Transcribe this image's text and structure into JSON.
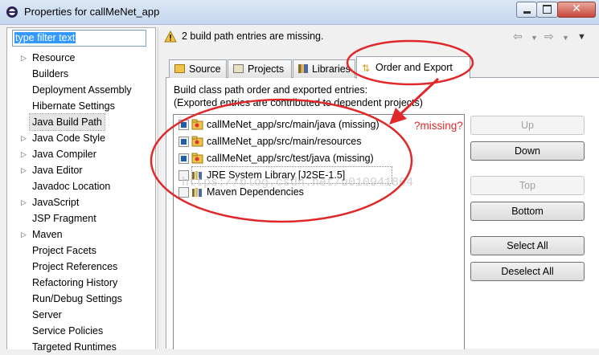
{
  "window": {
    "title": "Properties for callMeNet_app"
  },
  "filter": {
    "value": "type filter text"
  },
  "tree": {
    "items": [
      {
        "label": "Resource",
        "arrow": true
      },
      {
        "label": "Builders",
        "arrow": false
      },
      {
        "label": "Deployment Assembly",
        "arrow": false
      },
      {
        "label": "Hibernate Settings",
        "arrow": false
      },
      {
        "label": "Java Build Path",
        "arrow": false,
        "selected": true
      },
      {
        "label": "Java Code Style",
        "arrow": true
      },
      {
        "label": "Java Compiler",
        "arrow": true
      },
      {
        "label": "Java Editor",
        "arrow": true
      },
      {
        "label": "Javadoc Location",
        "arrow": false
      },
      {
        "label": "JavaScript",
        "arrow": true
      },
      {
        "label": "JSP Fragment",
        "arrow": false
      },
      {
        "label": "Maven",
        "arrow": true
      },
      {
        "label": "Project Facets",
        "arrow": false
      },
      {
        "label": "Project References",
        "arrow": false
      },
      {
        "label": "Refactoring History",
        "arrow": false
      },
      {
        "label": "Run/Debug Settings",
        "arrow": false
      },
      {
        "label": "Server",
        "arrow": false
      },
      {
        "label": "Service Policies",
        "arrow": false
      },
      {
        "label": "Targeted Runtimes",
        "arrow": false
      }
    ]
  },
  "header": {
    "warning": "2 build path entries are missing."
  },
  "tabs": [
    {
      "label": "Source"
    },
    {
      "label": "Projects"
    },
    {
      "label": "Libraries"
    },
    {
      "label": "Order and Export",
      "active": true
    }
  ],
  "panel": {
    "desc1": "Build class path order and exported entries:",
    "desc2": "(Exported entries are contributed to dependent projects)"
  },
  "entries": [
    {
      "label": "callMeNet_app/src/main/java (missing)",
      "checked": true,
      "icon": "source-folder-icon"
    },
    {
      "label": "callMeNet_app/src/main/resources",
      "checked": true,
      "icon": "source-folder-icon"
    },
    {
      "label": "callMeNet_app/src/test/java (missing)",
      "checked": true,
      "icon": "source-folder-icon"
    },
    {
      "label": "JRE System Library [J2SE-1.5]",
      "checked": false,
      "icon": "library-icon"
    },
    {
      "label": "Maven Dependencies",
      "checked": false,
      "icon": "library-icon"
    }
  ],
  "buttons": {
    "up": "Up",
    "down": "Down",
    "top": "Top",
    "bottom": "Bottom",
    "select_all": "Select All",
    "deselect_all": "Deselect All"
  },
  "annotation": {
    "text": "?missing?",
    "color": "#e0282a"
  },
  "watermark": "https://blog.csdn.net/u010941864"
}
